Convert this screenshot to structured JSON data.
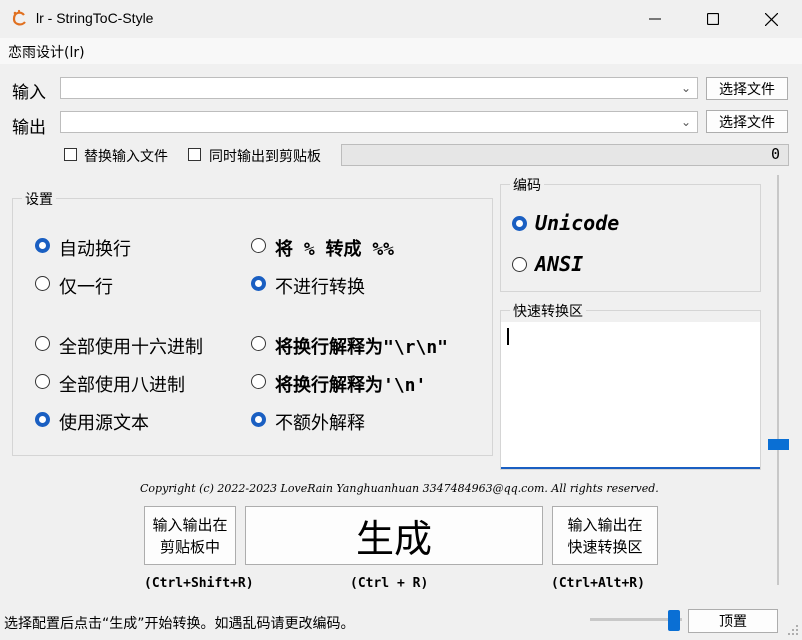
{
  "window": {
    "title": "lr - StringToC-Style"
  },
  "menu": {
    "item": "恋雨设计(lr)"
  },
  "input_row": {
    "label": "输入",
    "value": "",
    "button": "选择文件"
  },
  "output_row": {
    "label": "输出",
    "value": "",
    "button": "选择文件"
  },
  "options": {
    "replace_input": "替换输入文件",
    "copy_clipboard": "同时输出到剪贴板",
    "progress_text": "0"
  },
  "settings": {
    "title": "设置",
    "auto_wrap": "自动换行",
    "single_line": "仅一行",
    "percent_label": "将 % 转成 %%",
    "no_convert": "不进行转换",
    "hex_all": "全部使用十六进制",
    "oct_all": "全部使用八进制",
    "use_source": "使用源文本",
    "crlf": "将换行解释为\"\\r\\n\"",
    "lf": "将换行解释为'\\n'",
    "no_extra": "不额外解释"
  },
  "encoding": {
    "title": "编码",
    "unicode": "Unicode",
    "ansi": "ANSI"
  },
  "quick": {
    "title": "快速转换区",
    "value": ""
  },
  "copyright": "Copyright (c) 2022-2023 LoveRain Yanghuanhuan 3347484963@qq.com.  All rights reserved.",
  "buttons": {
    "clipboard": "输入输出在\n剪贴板中",
    "generate": "生成",
    "quick": "输入输出在\n快速转换区",
    "clipboard_shortcut": "(Ctrl+Shift+R)",
    "generate_shortcut": "(Ctrl + R)",
    "quick_shortcut": "(Ctrl+Alt+R)"
  },
  "status": {
    "text": "选择配置后点击“生成”开始转换。如遇乱码请更改编码。",
    "pin_button": "顶置"
  },
  "colors": {
    "accent": "#1a5fc2",
    "slider": "#0a6fd4"
  }
}
